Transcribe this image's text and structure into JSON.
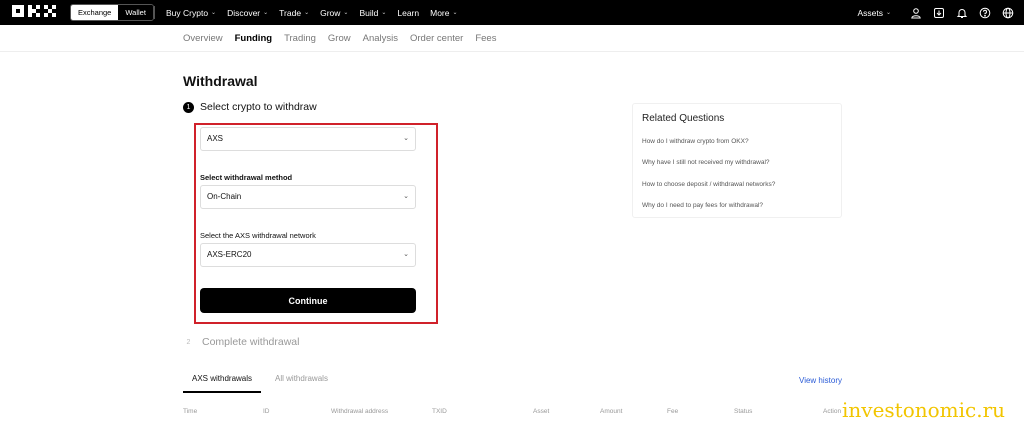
{
  "topnav": {
    "mode_exchange": "Exchange",
    "mode_wallet": "Wallet",
    "menu": [
      "Buy Crypto",
      "Discover",
      "Trade",
      "Grow",
      "Build",
      "Learn",
      "More"
    ],
    "assets": "Assets"
  },
  "subnav": {
    "items": [
      "Overview",
      "Funding",
      "Trading",
      "Grow",
      "Analysis",
      "Order center",
      "Fees"
    ],
    "active": "Funding"
  },
  "page": {
    "title": "Withdrawal",
    "step1_number": "1",
    "step1_label": "Select crypto to withdraw",
    "crypto_value": "AXS",
    "method_label": "Select withdrawal method",
    "method_value": "On-Chain",
    "network_label": "Select the AXS withdrawal network",
    "network_value": "AXS-ERC20",
    "continue_label": "Continue",
    "step2_number": "2",
    "step2_label": "Complete withdrawal",
    "highlight_color": "#d0212a"
  },
  "related": {
    "title": "Related Questions",
    "questions": [
      "How do I withdraw crypto from OKX?",
      "Why have I still not received my withdrawal?",
      "How to choose deposit / withdrawal networks?",
      "Why do I need to pay fees for withdrawal?"
    ]
  },
  "history": {
    "tabs": [
      "AXS withdrawals",
      "All withdrawals"
    ],
    "view_history": "View history",
    "columns": [
      "Time",
      "ID",
      "Withdrawal address",
      "TXID",
      "Asset",
      "Amount",
      "Fee",
      "Status",
      "Action"
    ]
  },
  "watermark": "investonomic.ru"
}
